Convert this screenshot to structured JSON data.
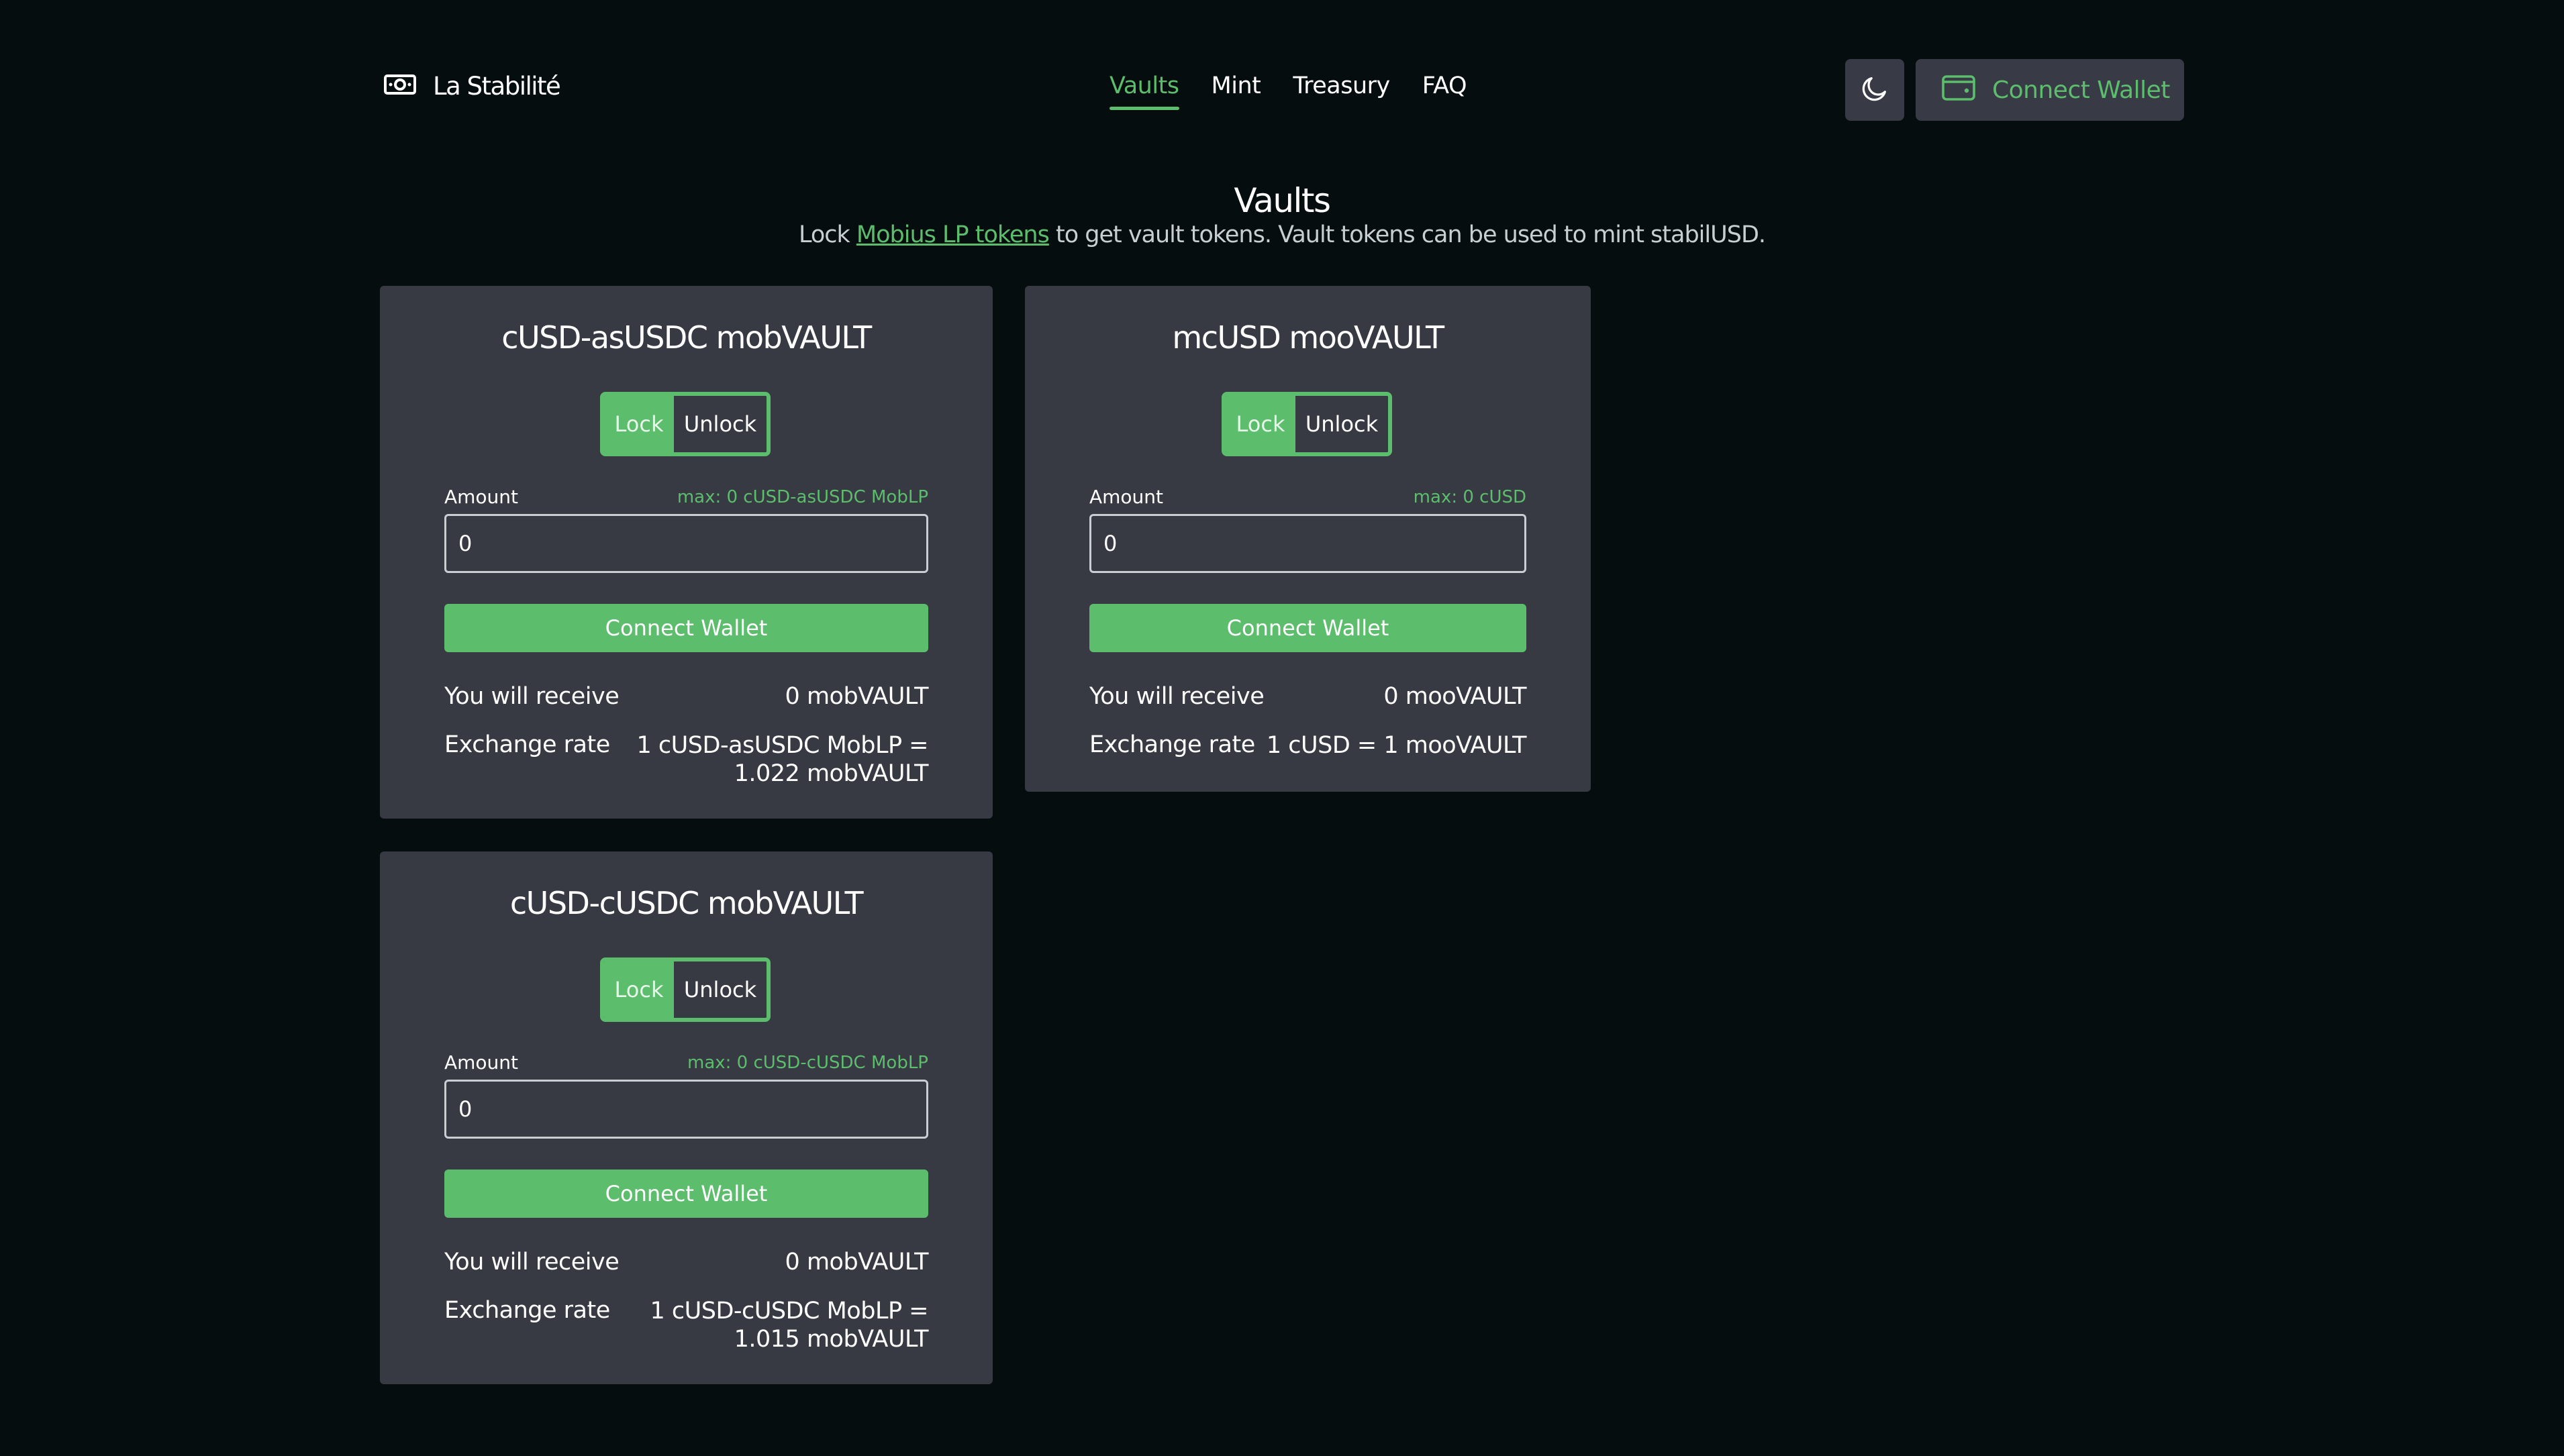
{
  "header": {
    "logo_text": "La Stabilité",
    "nav": [
      {
        "label": "Vaults"
      },
      {
        "label": "Mint"
      },
      {
        "label": "Treasury"
      },
      {
        "label": "FAQ"
      }
    ],
    "active_nav": "Vaults",
    "connect_wallet_label": "Connect Wallet"
  },
  "intro": {
    "title": "Vaults",
    "subtitle_prefix": "Lock ",
    "subtitle_link": "Mobius LP tokens",
    "subtitle_suffix": " to get vault tokens. Vault tokens can be used to mint stabilUSD."
  },
  "vaults": [
    {
      "title": "cUSD-asUSDC mobVAULT",
      "lock_label": "Lock",
      "unlock_label": "Unlock",
      "amount_label": "Amount",
      "max_label": "max: 0 cUSD-asUSDC MobLP",
      "amount_value": "0",
      "button_label": "Connect Wallet",
      "receive_label": "You will receive",
      "receive_value": "0 mobVAULT",
      "rate_label": "Exchange rate",
      "rate_line1": "1 cUSD-asUSDC MobLP =",
      "rate_line2": "1.022 mobVAULT"
    },
    {
      "title": "mcUSD mooVAULT",
      "lock_label": "Lock",
      "unlock_label": "Unlock",
      "amount_label": "Amount",
      "max_label": "max: 0 cUSD",
      "amount_value": "0",
      "button_label": "Connect Wallet",
      "receive_label": "You will receive",
      "receive_value": "0 mooVAULT",
      "rate_label": "Exchange rate",
      "rate_line1": "1 cUSD = 1 mooVAULT",
      "rate_line2": ""
    },
    {
      "title": "cUSD-cUSDC mobVAULT",
      "lock_label": "Lock",
      "unlock_label": "Unlock",
      "amount_label": "Amount",
      "max_label": "max: 0 cUSD-cUSDC MobLP",
      "amount_value": "0",
      "button_label": "Connect Wallet",
      "receive_label": "You will receive",
      "receive_value": "0 mobVAULT",
      "rate_label": "Exchange rate",
      "rate_line1": "1 cUSD-cUSDC MobLP =",
      "rate_line2": "1.015 mobVAULT"
    }
  ],
  "colors": {
    "background": "#060d0f",
    "card": "#373943",
    "accent": "#5cbd6c"
  },
  "icons": {
    "logo": "money-icon",
    "theme": "moon-icon",
    "wallet": "wallet-icon"
  }
}
